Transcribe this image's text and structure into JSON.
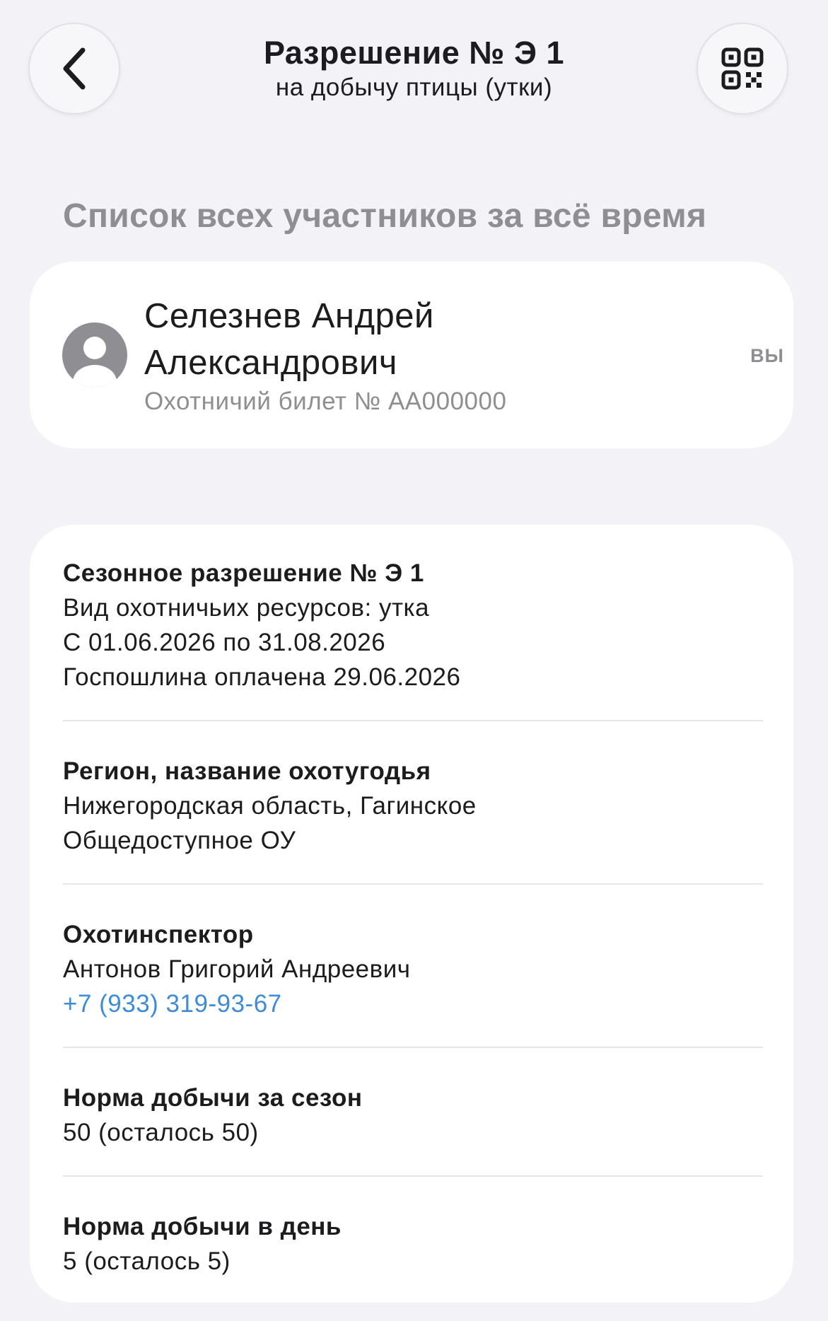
{
  "header": {
    "title": "Разрешение № Э 1",
    "subtitle": "на добычу птицы (утки)",
    "back_icon": "chevron-left-icon",
    "qr_icon": "qr-code-icon"
  },
  "participants": {
    "heading": "Список всех участников за всё время",
    "items": [
      {
        "name": "Селезнев Андрей Александрович",
        "ticket": "Охотничий билет № АА000000",
        "badge": "ВЫ",
        "avatar_icon": "person-avatar-icon"
      }
    ]
  },
  "details": {
    "permit": {
      "title": "Сезонное разрешение № Э 1",
      "resource": "Вид охотничьих ресурсов: утка",
      "period": "С 01.06.2026 по 31.08.2026",
      "fee": "Госпошлина оплачена 29.06.2026"
    },
    "region": {
      "title": "Регион, название охотугодья",
      "line1": "Нижегородская область, Гагинское",
      "line2": "Общедоступное ОУ"
    },
    "inspector": {
      "title": "Охотинспектор",
      "name": "Антонов Григорий Андреевич",
      "phone": "+7 (933) 319-93-67"
    },
    "season_limit": {
      "title": "Норма добычи за сезон",
      "value": "50 (осталось 50)"
    },
    "day_limit": {
      "title": "Норма добычи в день",
      "value": "5 (осталось 5)"
    }
  },
  "colors": {
    "background": "#f2f2f7",
    "card": "#ffffff",
    "secondary_text": "#8e8e93",
    "link": "#3d8bd9"
  }
}
